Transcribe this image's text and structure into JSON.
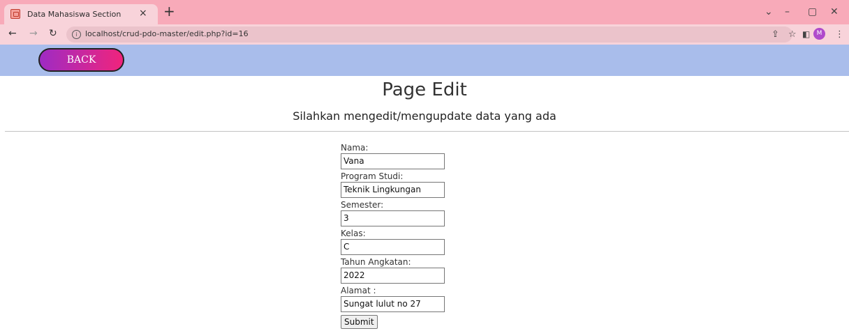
{
  "browser": {
    "tab_title": "Data Mahasiswa Section",
    "tab_close": "×",
    "new_tab": "+",
    "url": "localhost/crud-pdo-master/edit.php?id=16",
    "avatar_letter": "M"
  },
  "nav": {
    "back_label": "BACK"
  },
  "page": {
    "title": "Page Edit",
    "subtitle": "Silahkan mengedit/mengupdate data yang ada"
  },
  "form": {
    "fields": [
      {
        "label": "Nama:",
        "value": "Vana"
      },
      {
        "label": "Program Studi:",
        "value": "Teknik Lingkungan"
      },
      {
        "label": "Semester:",
        "value": "3"
      },
      {
        "label": "Kelas:",
        "value": "C"
      },
      {
        "label": "Tahun Angkatan:",
        "value": "2022"
      },
      {
        "label": "Alamat :",
        "value": "Sungat lulut no 27"
      }
    ],
    "submit_label": "Submit"
  },
  "colors": {
    "tabbar": "#f8aab9",
    "nav_band": "#a9bdeb",
    "back_gradient_start": "#9e2bc4",
    "back_gradient_end": "#f0247c"
  }
}
